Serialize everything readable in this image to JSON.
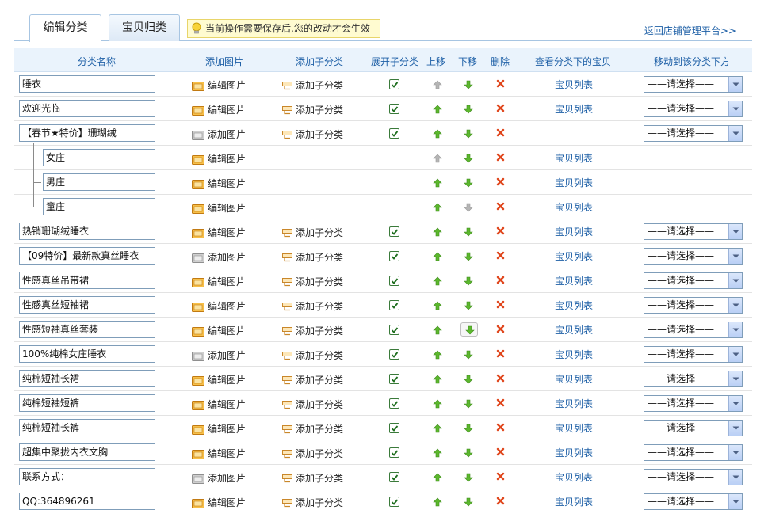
{
  "tabs": [
    {
      "label": "编辑分类",
      "active": true
    },
    {
      "label": "宝贝归类",
      "active": false
    }
  ],
  "notice": "当前操作需要保存后,您的改动才会生效",
  "back_link": "返回店铺管理平台>>",
  "headers": {
    "name": "分类名称",
    "image": "添加图片",
    "subcat": "添加子分类",
    "expand": "展开子分类",
    "up": "上移",
    "down": "下移",
    "delete": "删除",
    "view": "查看分类下的宝贝",
    "move": "移动到该分类下方"
  },
  "labels": {
    "edit_image": "编辑图片",
    "add_image": "添加图片",
    "add_subcat": "添加子分类",
    "item_list": "宝贝列表",
    "select_placeholder": "——请选择——"
  },
  "colors": {
    "link": "#1d5fa6",
    "header_bg": "#eaf3fc",
    "up_arrow": "#5cb82e",
    "disabled_arrow": "#b5b5b5",
    "delete": "#e0461c",
    "notice_bg": "#fffbd0"
  },
  "rows": [
    {
      "name": "睡衣",
      "level": 0,
      "image": "edit",
      "has_image_icon": "folder-orange",
      "subcat": true,
      "expanded": true,
      "up_enabled": false,
      "down_enabled": true,
      "down_framed": false,
      "item_list": true,
      "select": true
    },
    {
      "name": "欢迎光临",
      "level": 0,
      "image": "edit",
      "has_image_icon": "folder-orange",
      "subcat": true,
      "expanded": true,
      "up_enabled": true,
      "down_enabled": true,
      "down_framed": false,
      "item_list": true,
      "select": true
    },
    {
      "name": "【春节★特价】珊瑚绒",
      "level": 0,
      "image": "add",
      "has_image_icon": "folder-gray",
      "subcat": true,
      "expanded": true,
      "up_enabled": true,
      "down_enabled": true,
      "down_framed": false,
      "item_list": false,
      "select": true
    },
    {
      "name": "女庄",
      "level": 1,
      "image": "edit",
      "has_image_icon": "folder-orange",
      "subcat": false,
      "expanded": null,
      "up_enabled": false,
      "down_enabled": true,
      "down_framed": false,
      "item_list": true,
      "select": false
    },
    {
      "name": "男庄",
      "level": 1,
      "image": "edit",
      "has_image_icon": "folder-orange",
      "subcat": false,
      "expanded": null,
      "up_enabled": true,
      "down_enabled": true,
      "down_framed": false,
      "item_list": true,
      "select": false
    },
    {
      "name": "童庄",
      "level": 1,
      "image": "edit",
      "has_image_icon": "folder-orange",
      "subcat": false,
      "expanded": null,
      "up_enabled": true,
      "down_enabled": false,
      "down_framed": false,
      "item_list": true,
      "select": false
    },
    {
      "name": "热销珊瑚绒睡衣",
      "level": 0,
      "image": "edit",
      "has_image_icon": "folder-orange",
      "subcat": true,
      "expanded": true,
      "up_enabled": true,
      "down_enabled": true,
      "down_framed": false,
      "item_list": true,
      "select": true
    },
    {
      "name": "【09特价】最新款真丝睡衣",
      "level": 0,
      "image": "add",
      "has_image_icon": "folder-gray",
      "subcat": true,
      "expanded": true,
      "up_enabled": true,
      "down_enabled": true,
      "down_framed": false,
      "item_list": true,
      "select": true
    },
    {
      "name": "性感真丝吊带裙",
      "level": 0,
      "image": "edit",
      "has_image_icon": "folder-orange",
      "subcat": true,
      "expanded": true,
      "up_enabled": true,
      "down_enabled": true,
      "down_framed": false,
      "item_list": true,
      "select": true
    },
    {
      "name": "性感真丝短袖裙",
      "level": 0,
      "image": "edit",
      "has_image_icon": "folder-orange",
      "subcat": true,
      "expanded": true,
      "up_enabled": true,
      "down_enabled": true,
      "down_framed": false,
      "item_list": true,
      "select": true
    },
    {
      "name": "性感短袖真丝套装",
      "level": 0,
      "image": "edit",
      "has_image_icon": "folder-orange",
      "subcat": true,
      "expanded": true,
      "up_enabled": true,
      "down_enabled": true,
      "down_framed": true,
      "item_list": true,
      "select": true
    },
    {
      "name": "100%纯棉女庄睡衣",
      "level": 0,
      "image": "add",
      "has_image_icon": "folder-gray",
      "subcat": true,
      "expanded": true,
      "up_enabled": true,
      "down_enabled": true,
      "down_framed": false,
      "item_list": true,
      "select": true
    },
    {
      "name": "纯棉短袖长裙",
      "level": 0,
      "image": "edit",
      "has_image_icon": "folder-orange",
      "subcat": true,
      "expanded": true,
      "up_enabled": true,
      "down_enabled": true,
      "down_framed": false,
      "item_list": true,
      "select": true
    },
    {
      "name": "纯棉短袖短裤",
      "level": 0,
      "image": "edit",
      "has_image_icon": "folder-orange",
      "subcat": true,
      "expanded": true,
      "up_enabled": true,
      "down_enabled": true,
      "down_framed": false,
      "item_list": true,
      "select": true
    },
    {
      "name": "纯棉短袖长裤",
      "level": 0,
      "image": "edit",
      "has_image_icon": "folder-orange",
      "subcat": true,
      "expanded": true,
      "up_enabled": true,
      "down_enabled": true,
      "down_framed": false,
      "item_list": true,
      "select": true
    },
    {
      "name": "超集中聚拢内衣文胸",
      "level": 0,
      "image": "edit",
      "has_image_icon": "folder-orange",
      "subcat": true,
      "expanded": true,
      "up_enabled": true,
      "down_enabled": true,
      "down_framed": false,
      "item_list": true,
      "select": true
    },
    {
      "name": "联系方式：",
      "level": 0,
      "image": "add",
      "has_image_icon": "folder-gray",
      "subcat": true,
      "expanded": true,
      "up_enabled": true,
      "down_enabled": true,
      "down_framed": false,
      "item_list": true,
      "select": true
    },
    {
      "name": "QQ:364896261",
      "level": 0,
      "image": "edit",
      "has_image_icon": "folder-orange",
      "subcat": true,
      "expanded": true,
      "up_enabled": true,
      "down_enabled": true,
      "down_framed": false,
      "item_list": true,
      "select": true
    }
  ]
}
